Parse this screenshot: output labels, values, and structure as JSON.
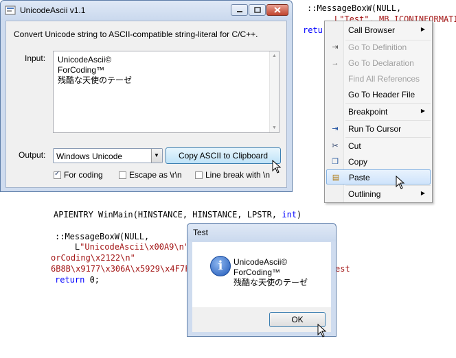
{
  "code_top": {
    "line1": "::MessageBoxW(NULL,",
    "line2_prefix": "L\"Test\", MB_ICONINFORMATIC",
    "line3": "retur"
  },
  "code_bottom": {
    "line1_a": "APIENTRY WinMain(HINSTANCE, HINSTANCE, LPSTR, ",
    "line1_kw": "int",
    "line1_b": ")",
    "line2": "::MessageBoxW(NULL,",
    "line3_a": "    L",
    "line3_str": "\"UnicodeAscii\\x00A9\\n\"",
    "line4": "orCoding\\x2122\\n\"",
    "line5": "6B8B\\x9177\\x306A\\x5929\\x4F7F",
    "line5_tail": "est",
    "line6_kw": "return",
    "line6_b": " 0;"
  },
  "main_window": {
    "title": "UnicodeAscii v1.1",
    "description": "Convert Unicode string to ASCII-compatible string-literal for C/C++.",
    "input_label": "Input:",
    "input_text": "UnicodeAscii©\nForCoding™\n残酷な天使のテーゼ",
    "output_label": "Output:",
    "output_selected": "Windows Unicode",
    "copy_button": "Copy ASCII to Clipboard",
    "checkboxes": [
      {
        "label": "For coding",
        "checked": true
      },
      {
        "label": "Escape as \\r\\n",
        "checked": false
      },
      {
        "label": "Line break with \\n",
        "checked": false
      }
    ]
  },
  "context_menu": {
    "items": [
      {
        "label": "Call Browser",
        "submenu": true,
        "enabled": true,
        "icon": ""
      },
      {
        "label": "Go To Definition",
        "submenu": false,
        "enabled": false,
        "icon": "goto-definition-icon"
      },
      {
        "label": "Go To Declaration",
        "submenu": false,
        "enabled": false,
        "icon": "goto-declaration-icon"
      },
      {
        "label": "Find All References",
        "submenu": false,
        "enabled": false,
        "icon": ""
      },
      {
        "label": "Go To Header File",
        "submenu": false,
        "enabled": true,
        "icon": ""
      },
      {
        "label": "Breakpoint",
        "submenu": true,
        "enabled": true,
        "icon": ""
      },
      {
        "label": "Run To Cursor",
        "submenu": false,
        "enabled": true,
        "icon": "run-to-cursor-icon"
      },
      {
        "label": "Cut",
        "submenu": false,
        "enabled": true,
        "icon": "cut-icon"
      },
      {
        "label": "Copy",
        "submenu": false,
        "enabled": true,
        "icon": "copy-icon"
      },
      {
        "label": "Paste",
        "submenu": false,
        "enabled": true,
        "icon": "paste-icon"
      },
      {
        "label": "Outlining",
        "submenu": true,
        "enabled": true,
        "icon": ""
      }
    ]
  },
  "message_box": {
    "title": "Test",
    "text": "UnicodeAscii©\nForCoding™\n残酷な天使のテーゼ",
    "ok_button": "OK"
  },
  "colors": {
    "keyword": "#0000ff",
    "string": "#a31515",
    "menu_highlight": "#cfe4fb"
  }
}
